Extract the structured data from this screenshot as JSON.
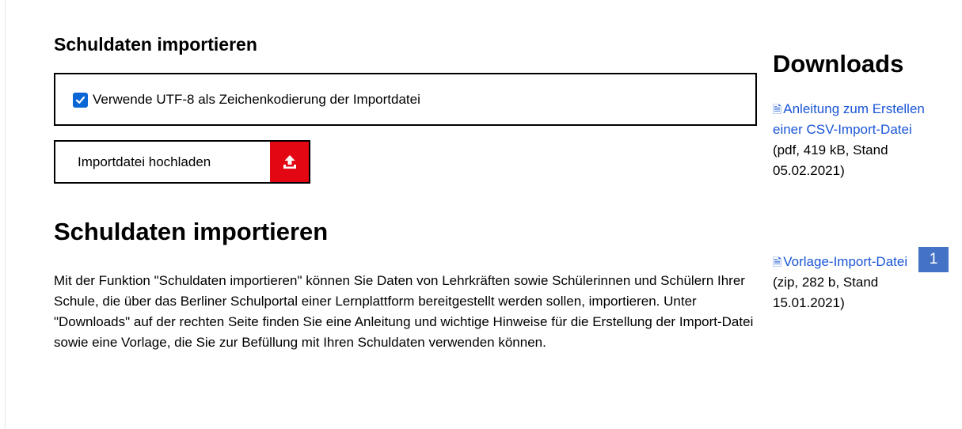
{
  "form": {
    "title": "Schuldaten importieren",
    "utf8_checkbox": {
      "checked": true,
      "label": "Verwende UTF-8 als Zeichenkodierung der Importdatei"
    },
    "upload_button": {
      "label": "Importdatei hochladen",
      "icon": "upload-icon",
      "color": "#e30613"
    }
  },
  "section": {
    "title": "Schuldaten importieren",
    "description": "Mit der Funktion \"Schuldaten importieren\" können Sie Daten von Lehrkräften sowie Schülerinnen und Schülern Ihrer Schule, die über das Berliner Schulportal einer Lernplattform bereitgestellt werden sollen, importieren. Unter \"Downloads\" auf der rechten Seite finden Sie eine Anleitung und wichtige Hinweise für die Erstellung der Import-Datei sowie eine Vorlage, die Sie zur Befüllung mit Ihren Schuldaten verwenden können."
  },
  "downloads": {
    "title": "Downloads",
    "link_color": "#1a55d6",
    "items": [
      {
        "icon": "document-icon",
        "label": "Anleitung zum Erstellen einer CSV-Import-Datei",
        "meta": "(pdf, 419 kB, Stand 05.02.2021)"
      },
      {
        "icon": "document-icon",
        "label": "Vorlage-Import-Datei",
        "meta": "(zip, 282 b, Stand 15.01.2021)"
      }
    ]
  },
  "badge": {
    "label": "1",
    "color": "#4472c4"
  }
}
